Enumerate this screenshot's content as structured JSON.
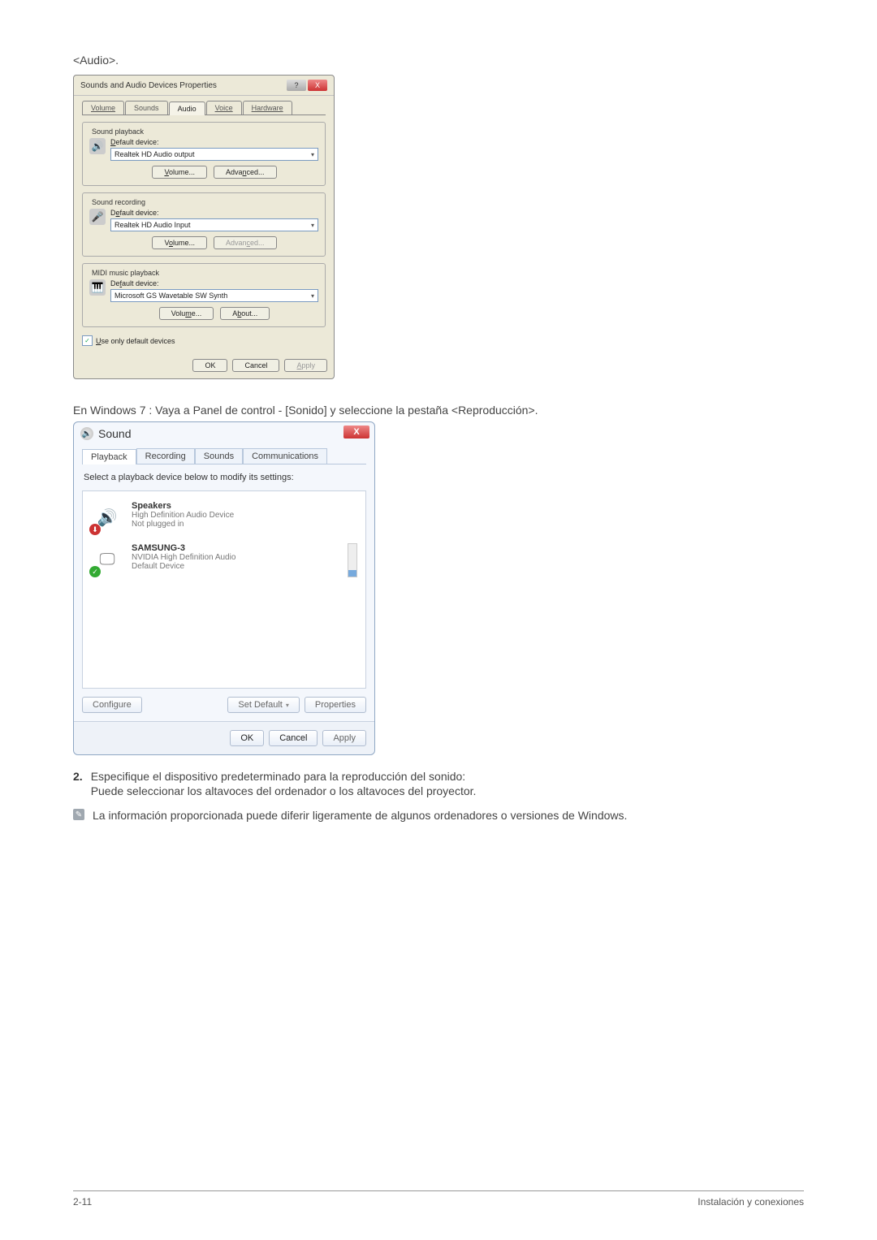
{
  "intro_audio": "<Audio>.",
  "xp_dialog": {
    "title": "Sounds and Audio Devices Properties",
    "tabs": {
      "volume": "Volume",
      "sounds": "Sounds",
      "audio": "Audio",
      "voice": "Voice",
      "hardware": "Hardware"
    },
    "playback": {
      "legend": "Sound playback",
      "label": "Default device:",
      "device": "Realtek HD Audio output",
      "volume_btn": "Volume...",
      "advanced_btn": "Advanced..."
    },
    "recording": {
      "legend": "Sound recording",
      "label": "Default device:",
      "device": "Realtek HD Audio Input",
      "volume_btn": "Volume...",
      "advanced_btn": "Advanced..."
    },
    "midi": {
      "legend": "MIDI music playback",
      "label": "Default device:",
      "device": "Microsoft GS Wavetable SW Synth",
      "volume_btn": "Volume...",
      "about_btn": "About..."
    },
    "use_default_checkbox": "Use only default devices",
    "ok": "OK",
    "cancel": "Cancel",
    "apply": "Apply"
  },
  "between_text": "En Windows 7 : Vaya a Panel de control - [Sonido] y seleccione la pestaña <Reproducción>.",
  "w7_dialog": {
    "title": "Sound",
    "tabs": {
      "playback": "Playback",
      "recording": "Recording",
      "sounds": "Sounds",
      "communications": "Communications"
    },
    "instruction": "Select a playback device below to modify its settings:",
    "devices": [
      {
        "name": "Speakers",
        "sub1": "High Definition Audio Device",
        "sub2": "Not plugged in",
        "badge": "red"
      },
      {
        "name": "SAMSUNG-3",
        "sub1": "NVIDIA High Definition Audio",
        "sub2": "Default Device",
        "badge": "green"
      }
    ],
    "configure": "Configure",
    "set_default": "Set Default",
    "properties": "Properties",
    "ok": "OK",
    "cancel": "Cancel",
    "apply": "Apply"
  },
  "step2_num": "2.",
  "step2_line1": "Especifique el dispositivo predeterminado para la reproducción del sonido:",
  "step2_line2": "Puede seleccionar los altavoces del ordenador o los altavoces del proyector.",
  "note_text": "La información proporcionada puede diferir ligeramente de algunos ordenadores o versiones de Windows.",
  "footer_left": "2-11",
  "footer_right": "Instalación y conexiones"
}
